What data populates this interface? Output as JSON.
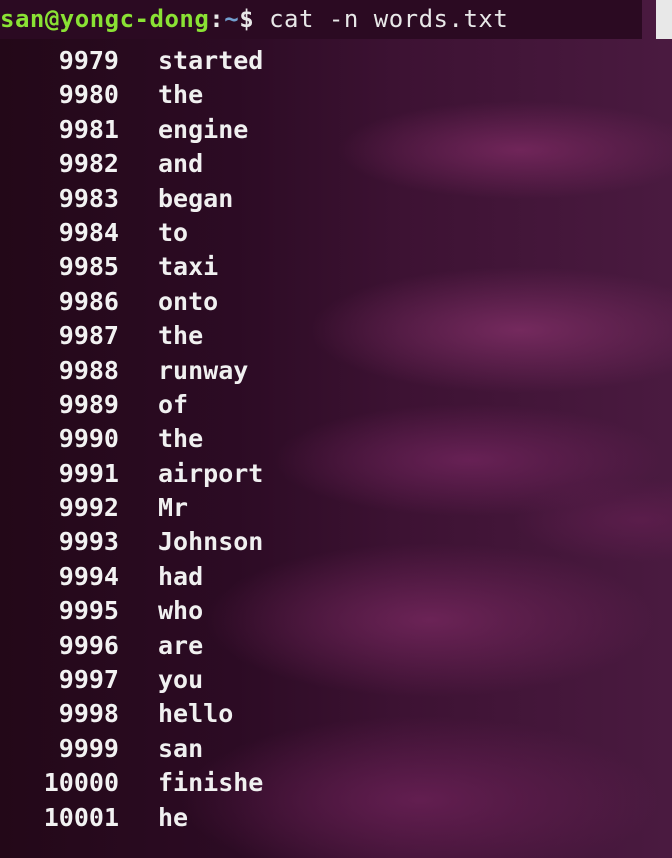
{
  "prompt": {
    "user_host": "san@yongc-dong",
    "colon": ":",
    "path": "~",
    "dollar": "$",
    "command": " cat -n words.txt"
  },
  "lines": [
    {
      "num": "9979",
      "word": "started"
    },
    {
      "num": "9980",
      "word": "the"
    },
    {
      "num": "9981",
      "word": "engine"
    },
    {
      "num": "9982",
      "word": "and"
    },
    {
      "num": "9983",
      "word": "began"
    },
    {
      "num": "9984",
      "word": "to"
    },
    {
      "num": "9985",
      "word": "taxi"
    },
    {
      "num": "9986",
      "word": "onto"
    },
    {
      "num": "9987",
      "word": "the"
    },
    {
      "num": "9988",
      "word": "runway"
    },
    {
      "num": "9989",
      "word": "of"
    },
    {
      "num": "9990",
      "word": "the"
    },
    {
      "num": "9991",
      "word": "airport"
    },
    {
      "num": "9992",
      "word": "Mr"
    },
    {
      "num": "9993",
      "word": "Johnson"
    },
    {
      "num": "9994",
      "word": "had"
    },
    {
      "num": "9995",
      "word": "who"
    },
    {
      "num": "9996",
      "word": "are"
    },
    {
      "num": "9997",
      "word": "you"
    },
    {
      "num": "9998",
      "word": "hello"
    },
    {
      "num": "9999",
      "word": "san"
    },
    {
      "num": "10000",
      "word": "finishe"
    },
    {
      "num": "10001",
      "word": "he"
    }
  ]
}
